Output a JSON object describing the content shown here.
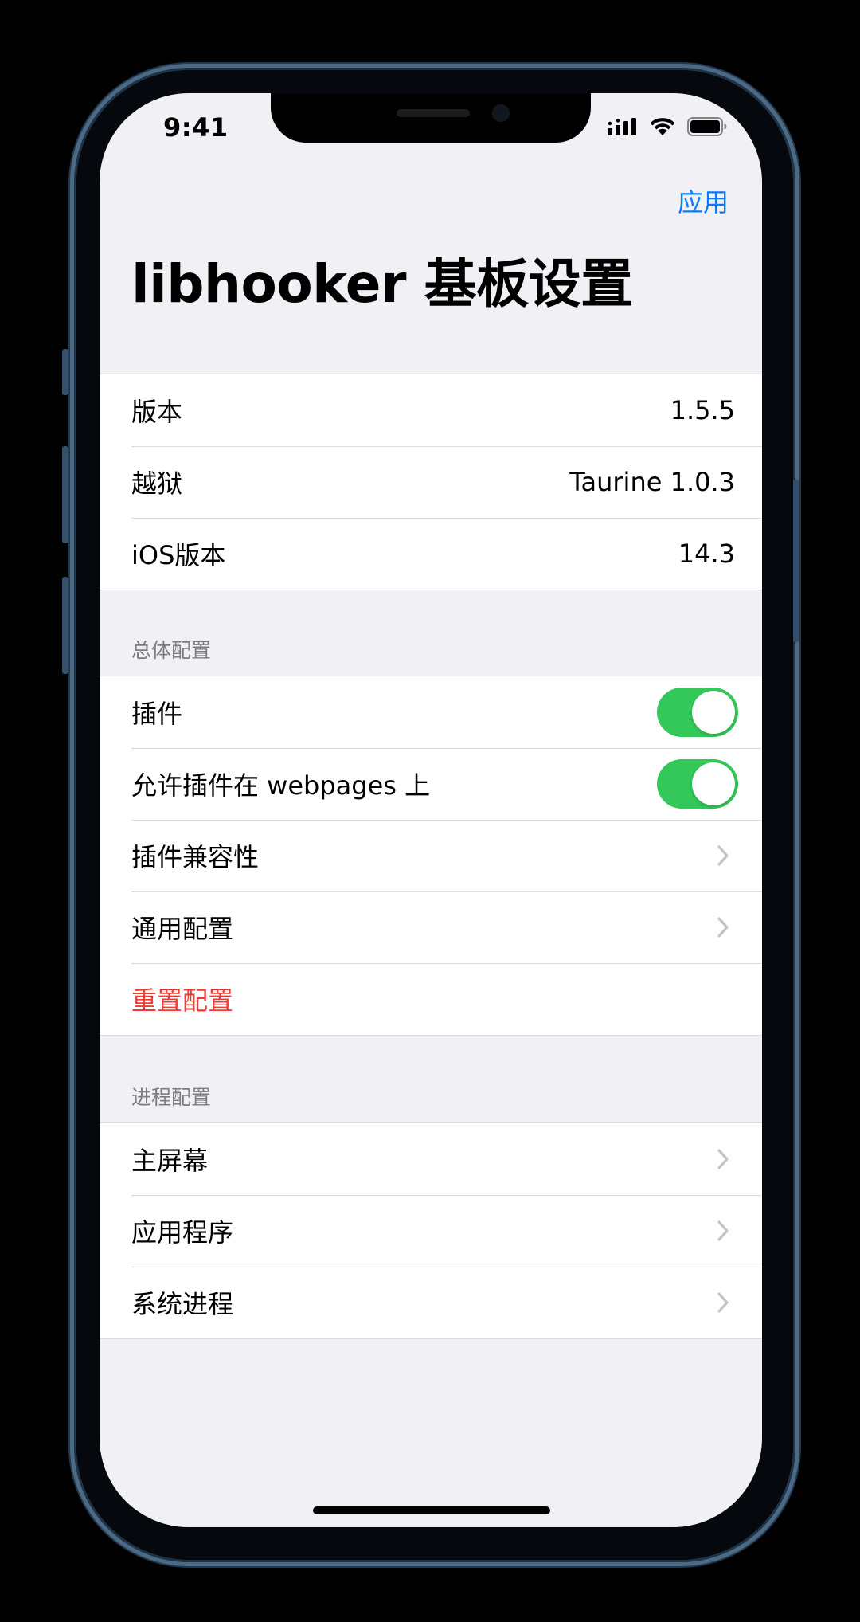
{
  "status_bar": {
    "time": "9:41",
    "signal_icon": "cellular-signal-icon",
    "wifi_icon": "wifi-icon",
    "battery_icon": "battery-icon"
  },
  "nav": {
    "apply_label": "应用",
    "title": "libhooker 基板设置"
  },
  "info_group": [
    {
      "label": "版本",
      "value": "1.5.5"
    },
    {
      "label": "越狱",
      "value": "Taurine 1.0.3"
    },
    {
      "label": "iOS版本",
      "value": "14.3"
    }
  ],
  "general_section": {
    "header": "总体配置",
    "tweaks": {
      "label": "插件",
      "enabled": true
    },
    "tweaks_on_webpages": {
      "label": "允许插件在 webpages 上",
      "enabled": true
    },
    "tweak_compatibility": {
      "label": "插件兼容性"
    },
    "general_config": {
      "label": "通用配置"
    },
    "reset_config": {
      "label": "重置配置"
    }
  },
  "process_section": {
    "header": "进程配置",
    "items": [
      {
        "label": "主屏幕"
      },
      {
        "label": "应用程序"
      },
      {
        "label": "系统进程"
      }
    ]
  },
  "colors": {
    "accent": "#0a7cff",
    "toggle_on": "#34c85a",
    "destructive": "#ef3a32",
    "grouped_background": "#f1f1f5",
    "section_header": "#7c7c82"
  }
}
